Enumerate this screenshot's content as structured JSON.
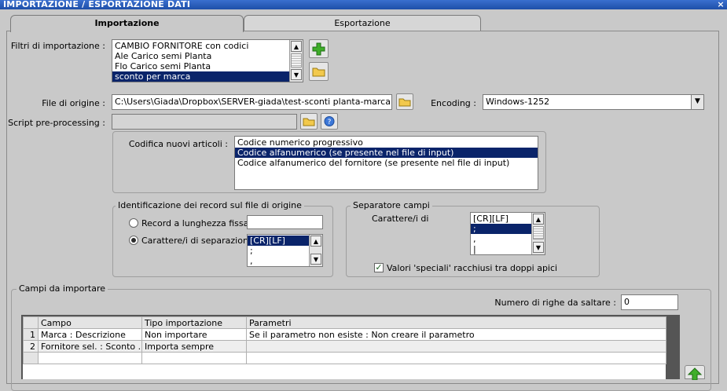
{
  "window": {
    "title": "IMPORTAZIONE / ESPORTAZIONE DATI",
    "close_label": "×"
  },
  "tabs": [
    {
      "label": "Importazione"
    },
    {
      "label": "Esportazione"
    }
  ],
  "filters": {
    "label": "Filtri di importazione :",
    "items": [
      "CAMBIO FORNITORE con codici",
      "Ale Carico semi Planta",
      "Flo Carico semi Planta",
      "sconto per marca"
    ],
    "selected_index": 3
  },
  "file_origin": {
    "label": "File di origine :",
    "value": "C:\\Users\\Giada\\Dropbox\\SERVER-giada\\test-sconti planta-marca.csv"
  },
  "encoding": {
    "label": "Encoding :",
    "value": "Windows-1252"
  },
  "script_pre": {
    "label": "Script pre-processing :",
    "value": ""
  },
  "codifica": {
    "label": "Codifica nuovi articoli :",
    "items": [
      "Codice numerico progressivo",
      "Codice alfanumerico (se presente nel file di input)",
      "Codice alfanumerico del fornitore (se presente nel file di input)"
    ],
    "selected_index": 1
  },
  "identificazione": {
    "title": "Identificazione dei record sul file di origine",
    "record_fissa_label": "Record a lunghezza fissa",
    "record_fissa_value": "",
    "separazione_label": "Carattere/i di separazione",
    "separazione_items": [
      "[CR][LF]",
      ";",
      ","
    ],
    "selected": "separazione"
  },
  "separatore": {
    "title": "Separatore campi",
    "label": "Carattere/i di",
    "items": [
      "[CR][LF]",
      ";",
      ",",
      "|"
    ],
    "selected_index": 1,
    "valori_speciali_label": "Valori 'speciali' racchiusi tra doppi apici",
    "valori_speciali_checked": true
  },
  "campi": {
    "title": "Campi da importare",
    "righe_label": "Numero di righe da saltare :",
    "righe_value": "0",
    "columns": [
      "Campo",
      "Tipo importazione",
      "Parametri"
    ],
    "rows": [
      {
        "n": "1",
        "campo": "Marca : Descrizione",
        "tipo": "Non importare",
        "param": "Se il parametro non esiste : Non creare il parametro"
      },
      {
        "n": "2",
        "campo": "Fornitore sel. : Sconto ....",
        "tipo": "Importa sempre",
        "param": ""
      }
    ]
  },
  "colors": {
    "titlebar": "#1e4fa8",
    "selection": "#0a246a",
    "panel": "#c9c9c9"
  },
  "icons": [
    "plus-icon",
    "folder-icon",
    "help-icon",
    "arrow-up-icon"
  ]
}
